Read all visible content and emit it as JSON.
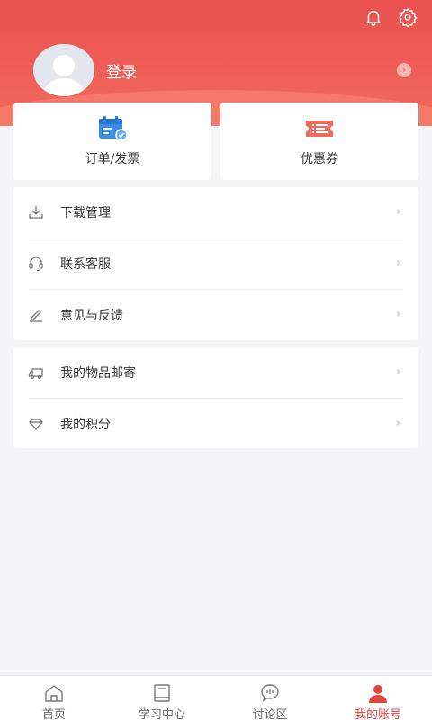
{
  "header": {
    "login_label": "登录",
    "icons": [
      "bell-icon",
      "gear-icon"
    ]
  },
  "quick_actions": [
    {
      "label": "订单/发票",
      "icon": "calendar-check-icon",
      "color": "#3a8ee6"
    },
    {
      "label": "优惠券",
      "icon": "coupon-icon",
      "color": "#f06b5c"
    }
  ],
  "menu_group_1": [
    {
      "label": "下载管理",
      "icon": "download-icon"
    },
    {
      "label": "联系客服",
      "icon": "headset-icon"
    },
    {
      "label": "意见与反馈",
      "icon": "edit-icon"
    }
  ],
  "menu_group_2": [
    {
      "label": "我的物品邮寄",
      "icon": "truck-icon"
    },
    {
      "label": "我的积分",
      "icon": "diamond-icon"
    }
  ],
  "tabbar": [
    {
      "label": "首页",
      "icon": "home-icon",
      "active": false
    },
    {
      "label": "学习中心",
      "icon": "book-icon",
      "active": false
    },
    {
      "label": "讨论区",
      "icon": "chat-icon",
      "active": false
    },
    {
      "label": "我的账号",
      "icon": "user-icon",
      "active": true
    }
  ],
  "colors": {
    "brand": "#e9514f",
    "active_tab": "#e2443e",
    "background": "#f4f5f7"
  }
}
